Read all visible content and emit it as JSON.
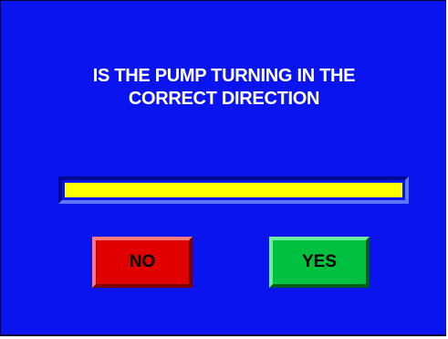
{
  "prompt": {
    "line1": "IS THE PUMP TURNING IN THE",
    "line2": "CORRECT DIRECTION"
  },
  "buttons": {
    "no_label": "NO",
    "yes_label": "YES"
  },
  "colors": {
    "background": "#0a14ee",
    "indicator": "#ffff00",
    "no_button": "#e00000",
    "yes_button": "#00c040",
    "text": "#ffffff"
  }
}
